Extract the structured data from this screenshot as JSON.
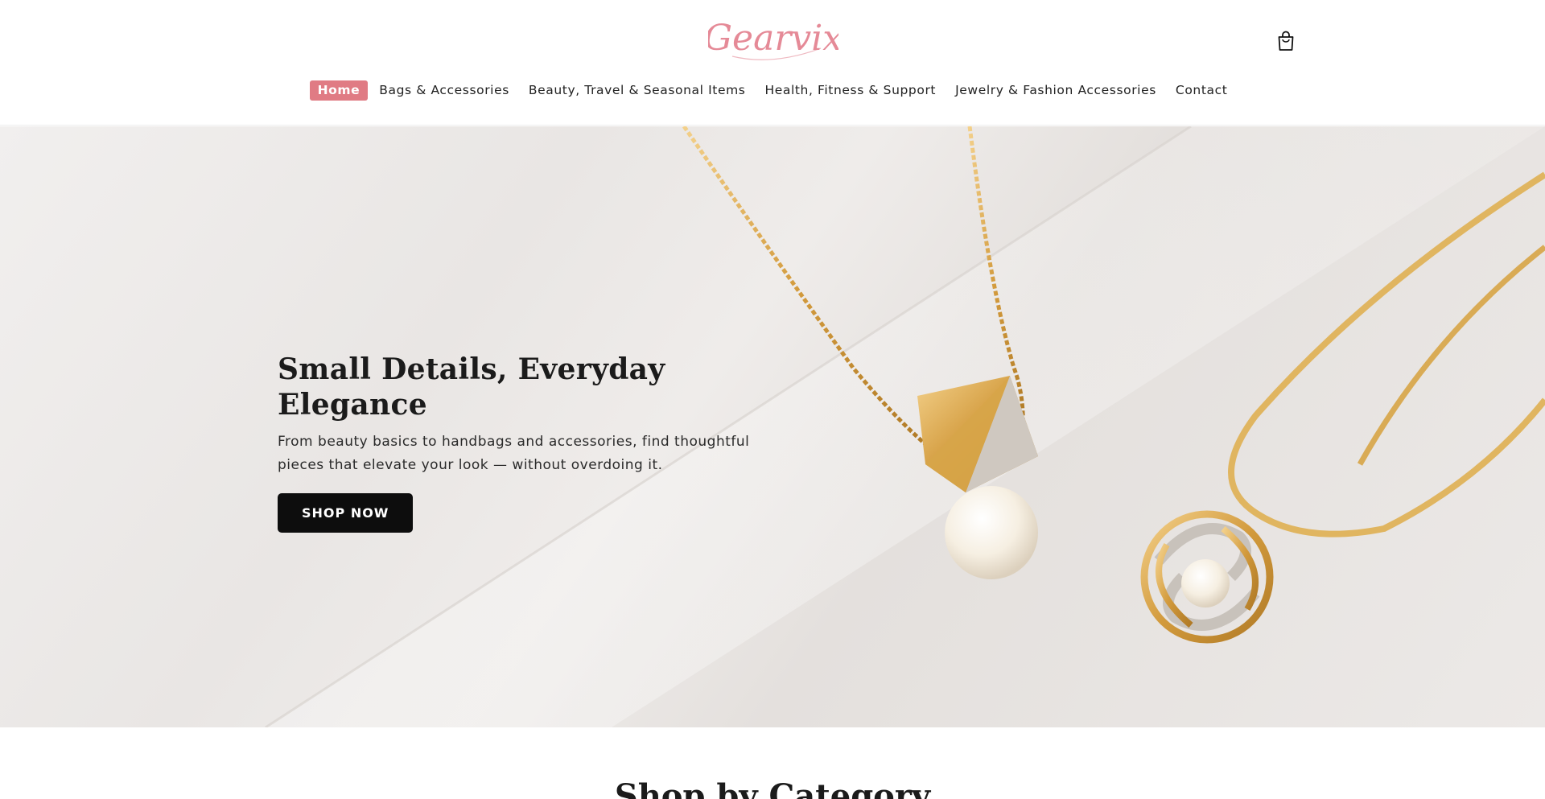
{
  "header": {
    "logo_text": "Gearvix",
    "cart_icon": "shopping-bag-icon"
  },
  "nav": {
    "items": [
      {
        "label": "Home",
        "active": true
      },
      {
        "label": "Bags & Accessories",
        "active": false
      },
      {
        "label": "Beauty, Travel & Seasonal Items",
        "active": false
      },
      {
        "label": "Health, Fitness & Support",
        "active": false
      },
      {
        "label": "Jewelry & Fashion Accessories",
        "active": false
      },
      {
        "label": "Contact",
        "active": false
      }
    ]
  },
  "hero": {
    "title": "Small Details, Everyday Elegance",
    "subtitle": "From beauty basics to handbags and accessories, find thoughtful pieces that elevate your look — without overdoing it.",
    "cta_label": "SHOP NOW"
  },
  "sections": {
    "category_title": "Shop by Category"
  },
  "colors": {
    "accent": "#e07b84",
    "button": "#0d0d0d",
    "logo": "#e58a97"
  }
}
